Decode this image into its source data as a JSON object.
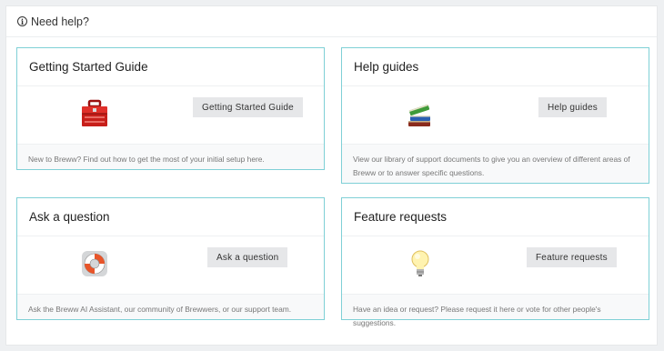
{
  "header": {
    "title": "Need help?",
    "icon": "info-icon"
  },
  "cards": [
    {
      "title": "Getting Started Guide",
      "button": "Getting Started Guide",
      "icon": "toolbox-icon",
      "description": "New to Breww? Find out how to get the most of your initial setup here."
    },
    {
      "title": "Help guides",
      "button": "Help guides",
      "icon": "books-icon",
      "description": "View our library of support documents to give you an overview of different areas of Breww or to answer specific questions."
    },
    {
      "title": "Ask a question",
      "button": "Ask a question",
      "icon": "lifebuoy-icon",
      "description": "Ask the Breww AI Assistant, our community of Brewwers, or our support team."
    },
    {
      "title": "Feature requests",
      "button": "Feature requests",
      "icon": "lightbulb-icon",
      "description": "Have an idea or request? Please request it here or vote for other people's suggestions."
    }
  ],
  "colors": {
    "card_border": "#7fd0d6",
    "button_bg": "#e6e7e9",
    "page_bg": "#eef0f2"
  }
}
